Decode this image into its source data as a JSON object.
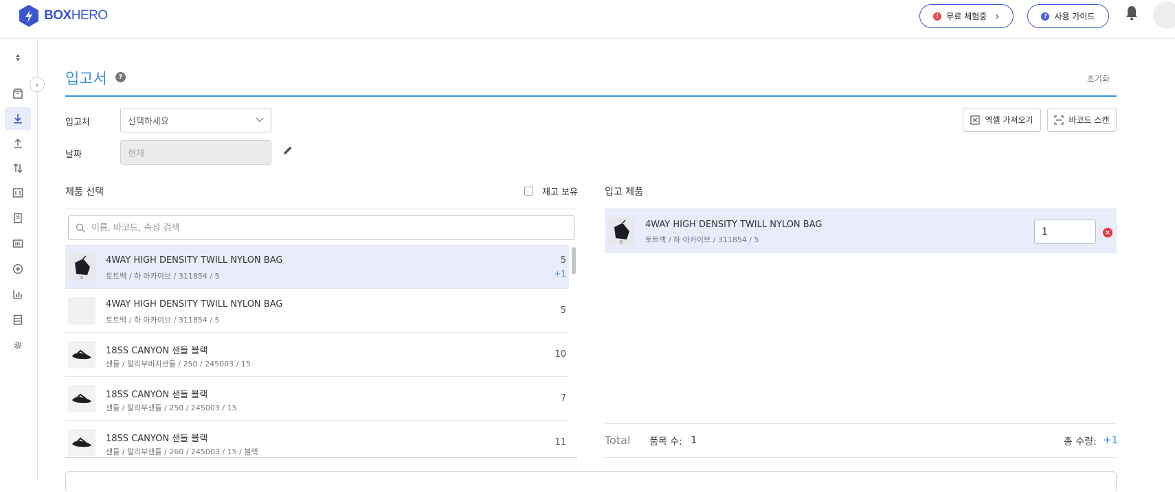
{
  "brand": {
    "name_bold": "BOX",
    "name_light": "HERO",
    "accent": "#3c55cf"
  },
  "topbar": {
    "trial": {
      "badge": "!",
      "label": "무료 체험중"
    },
    "guide": {
      "badge": "?",
      "label": "사용 가이드"
    }
  },
  "page": {
    "title": "입고서",
    "help": "?",
    "reset_label": "초기화"
  },
  "form": {
    "source_label": "입고처",
    "source_placeholder": "선택하세요",
    "date_label": "날짜",
    "date_value": "현재"
  },
  "tools": {
    "excel_label": "엑셀 가져오기",
    "barcode_label": "바코드 스캔"
  },
  "product_select": {
    "title": "제품 선택",
    "stock_only_label": "재고 보유",
    "search_placeholder": "이름, 바코드, 속성 검색",
    "items": [
      {
        "name": "4WAY HIGH DENSITY TWILL NYLON BAG",
        "sub": "토트백 / 하 아카이브 / 311854 / 5",
        "qty": "5",
        "added": "+1",
        "thumb": "bag"
      },
      {
        "name": "4WAY HIGH DENSITY TWILL NYLON BAG",
        "sub": "토트백 / 하 아카이브 / 311854 / 5",
        "qty": "5",
        "added": "",
        "thumb": "none"
      },
      {
        "name": "18SS CANYON 샌들 블랙",
        "sub": "샌들 / 말리부비치샌들 / 250 / 245003 / 15",
        "qty": "10",
        "added": "",
        "thumb": "sandal"
      },
      {
        "name": "18SS CANYON 샌들 블랙",
        "sub": "샌들 / 말리부샌들 / 250 / 245003 / 15",
        "qty": "7",
        "added": "",
        "thumb": "sandal"
      },
      {
        "name": "18SS CANYON 샌들 블랙",
        "sub": "샌들 / 말리부샌들 / 260 / 245003 / 15 / 블랙",
        "qty": "11",
        "added": "",
        "thumb": "sandal"
      }
    ]
  },
  "incoming": {
    "title": "입고 제품",
    "items": [
      {
        "name": "4WAY HIGH DENSITY TWILL NYLON BAG",
        "sub": "토트백 / 하 아카이브 / 311854 / 5",
        "qty": "1"
      }
    ],
    "total_label": "Total",
    "count_label": "품목 수:",
    "count_value": "1",
    "sum_label": "총 수량:",
    "sum_value": "+1"
  }
}
